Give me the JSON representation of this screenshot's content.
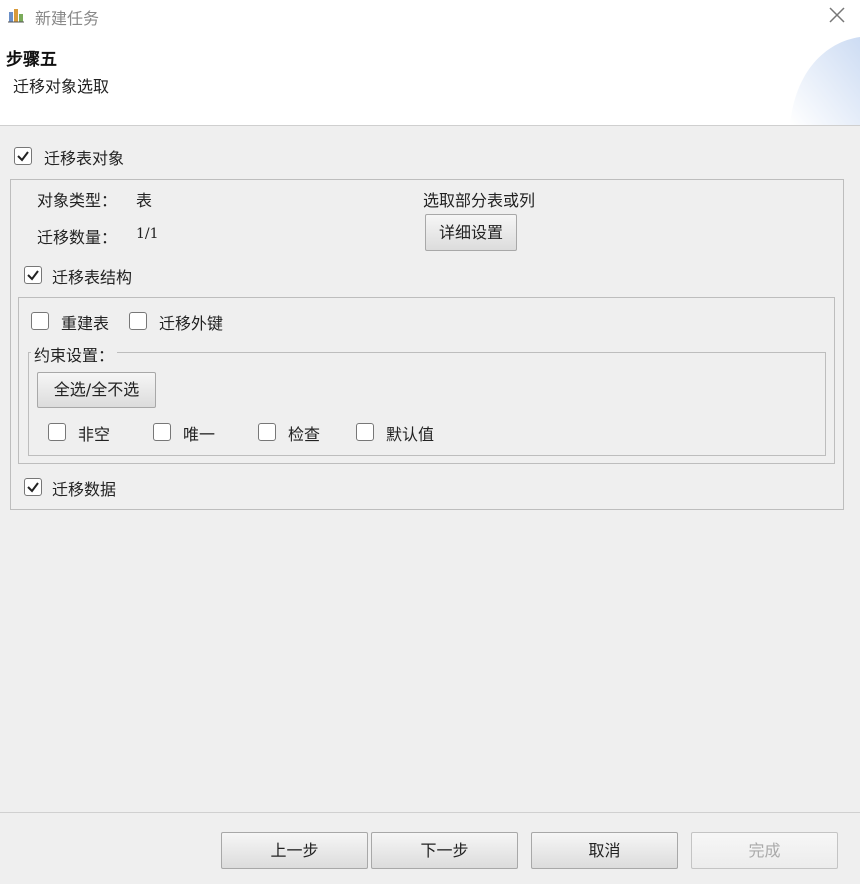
{
  "window": {
    "title": "新建任务",
    "icon": "app-task-icon",
    "close_icon": "close-icon"
  },
  "header": {
    "step_title": "步骤五",
    "step_subtitle": "迁移对象选取"
  },
  "migrate_table_objects": {
    "label": "迁移表对象",
    "checked": true
  },
  "info": {
    "object_type_label": "对象类型：",
    "object_type_value": "表",
    "count_label": "迁移数量：",
    "count_value": "1/1",
    "partial_select_label": "选取部分表或列",
    "detail_button": "详细设置"
  },
  "migrate_table_structure": {
    "label": "迁移表结构",
    "checked": true
  },
  "rebuild_table": {
    "label": "重建表",
    "checked": false
  },
  "migrate_foreign_keys": {
    "label": "迁移外键",
    "checked": false
  },
  "constraints": {
    "legend": "约束设置：",
    "select_all_button": "全选/全不选",
    "not_null": {
      "label": "非空",
      "checked": false
    },
    "unique": {
      "label": "唯一",
      "checked": false
    },
    "check": {
      "label": "检查",
      "checked": false
    },
    "default_value": {
      "label": "默认值",
      "checked": false
    }
  },
  "migrate_data": {
    "label": "迁移数据",
    "checked": true
  },
  "footer": {
    "prev": "上一步",
    "next": "下一步",
    "cancel": "取消",
    "finish": "完成"
  }
}
